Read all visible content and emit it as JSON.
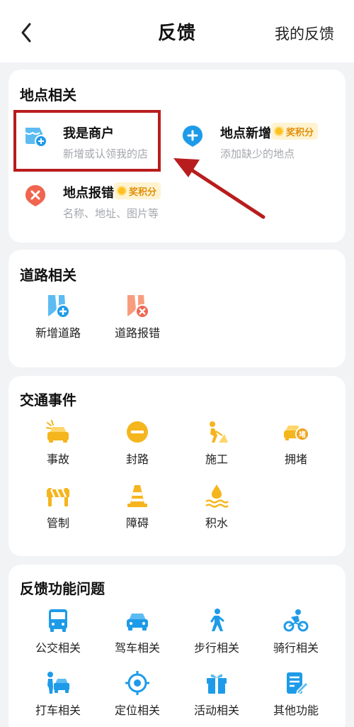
{
  "header": {
    "title": "反馈",
    "right_link": "我的反馈"
  },
  "place_section": {
    "title": "地点相关",
    "items": [
      {
        "name": "我是商户",
        "desc": "新增或认领我的店",
        "badge": ""
      },
      {
        "name": "地点新增",
        "desc": "添加缺少的地点",
        "badge": "奖积分"
      },
      {
        "name": "地点报错",
        "desc": "名称、地址、图片等",
        "badge": "奖积分"
      }
    ]
  },
  "road_section": {
    "title": "道路相关",
    "items": [
      {
        "label": "新增道路"
      },
      {
        "label": "道路报错"
      }
    ]
  },
  "traffic_section": {
    "title": "交通事件",
    "items": [
      {
        "label": "事故"
      },
      {
        "label": "封路"
      },
      {
        "label": "施工"
      },
      {
        "label": "拥堵"
      },
      {
        "label": "管制"
      },
      {
        "label": "障碍"
      },
      {
        "label": "积水"
      }
    ],
    "jam_icon_char": "堵"
  },
  "function_section": {
    "title": "反馈功能问题",
    "items": [
      {
        "label": "公交相关"
      },
      {
        "label": "驾车相关"
      },
      {
        "label": "步行相关"
      },
      {
        "label": "骑行相关"
      },
      {
        "label": "打车相关"
      },
      {
        "label": "定位相关"
      },
      {
        "label": "活动相关"
      },
      {
        "label": "其他功能"
      }
    ]
  },
  "colors": {
    "blue": "#1e9be8",
    "yellow": "#f5b51d",
    "red_icon": "#f0654f",
    "highlight": "#b81d1d",
    "badge_bg": "#fff3d1",
    "badge_text": "#e0900b"
  }
}
